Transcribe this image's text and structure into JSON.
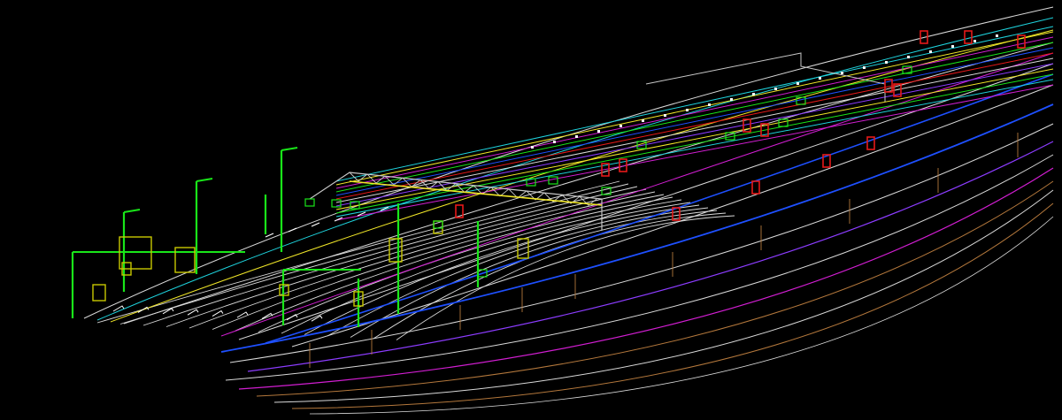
{
  "canvas": {
    "background": "#000000"
  },
  "layers": [
    {
      "name": "road-edge",
      "color": "#d9d9d9"
    },
    {
      "name": "lane-marking",
      "color": "#ffffff"
    },
    {
      "name": "signal-pole",
      "color": "#19e619"
    },
    {
      "name": "signal-head",
      "color": "#c8c800"
    },
    {
      "name": "sign-panel",
      "color": "#e61919"
    },
    {
      "name": "utility-blue",
      "color": "#1e50ff"
    },
    {
      "name": "utility-cyan",
      "color": "#1ed2dc"
    },
    {
      "name": "utility-magenta",
      "color": "#d21ed2"
    },
    {
      "name": "utility-purple",
      "color": "#8c3cff"
    },
    {
      "name": "utility-yellow",
      "color": "#f0e628"
    },
    {
      "name": "utility-orange",
      "color": "#b4783c"
    },
    {
      "name": "gantry",
      "color": "#c8c8c8"
    }
  ]
}
